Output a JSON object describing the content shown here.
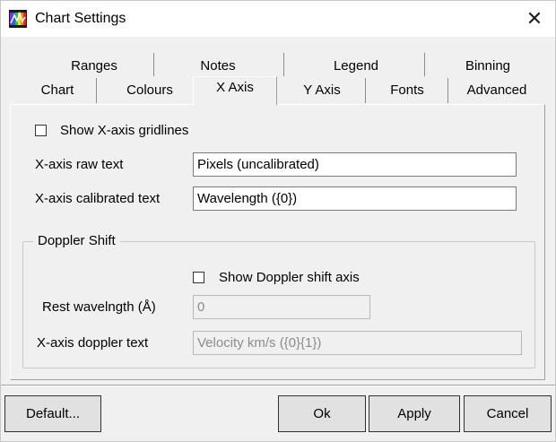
{
  "window": {
    "title": "Chart Settings",
    "icon": "app-spectrum-icon",
    "close_glyph": "✕"
  },
  "tabs": {
    "row_back": [
      {
        "label": "Ranges"
      },
      {
        "label": "Notes"
      },
      {
        "label": "Legend"
      },
      {
        "label": "Binning"
      }
    ],
    "row_front": [
      {
        "label": "Chart"
      },
      {
        "label": "Colours"
      },
      {
        "label": "X Axis",
        "active": true
      },
      {
        "label": "Y Axis"
      },
      {
        "label": "Fonts"
      },
      {
        "label": "Advanced"
      }
    ]
  },
  "x_axis": {
    "show_gridlines_label": "Show X-axis gridlines",
    "show_gridlines_checked": false,
    "raw_text_label": "X-axis raw text",
    "raw_text_value": "Pixels (uncalibrated)",
    "calibrated_text_label": "X-axis calibrated text",
    "calibrated_text_value": "Wavelength ({0})"
  },
  "doppler": {
    "group_title": "Doppler Shift",
    "show_axis_label": "Show Doppler shift axis",
    "show_axis_checked": false,
    "rest_wavelength_label": "Rest wavelngth (Å)",
    "rest_wavelength_value": "0",
    "axis_text_label": "X-axis doppler text",
    "axis_text_value": "Velocity km/s ({0}{1})"
  },
  "buttons": {
    "default_label": "Default...",
    "ok_label": "Ok",
    "apply_label": "Apply",
    "cancel_label": "Cancel"
  }
}
